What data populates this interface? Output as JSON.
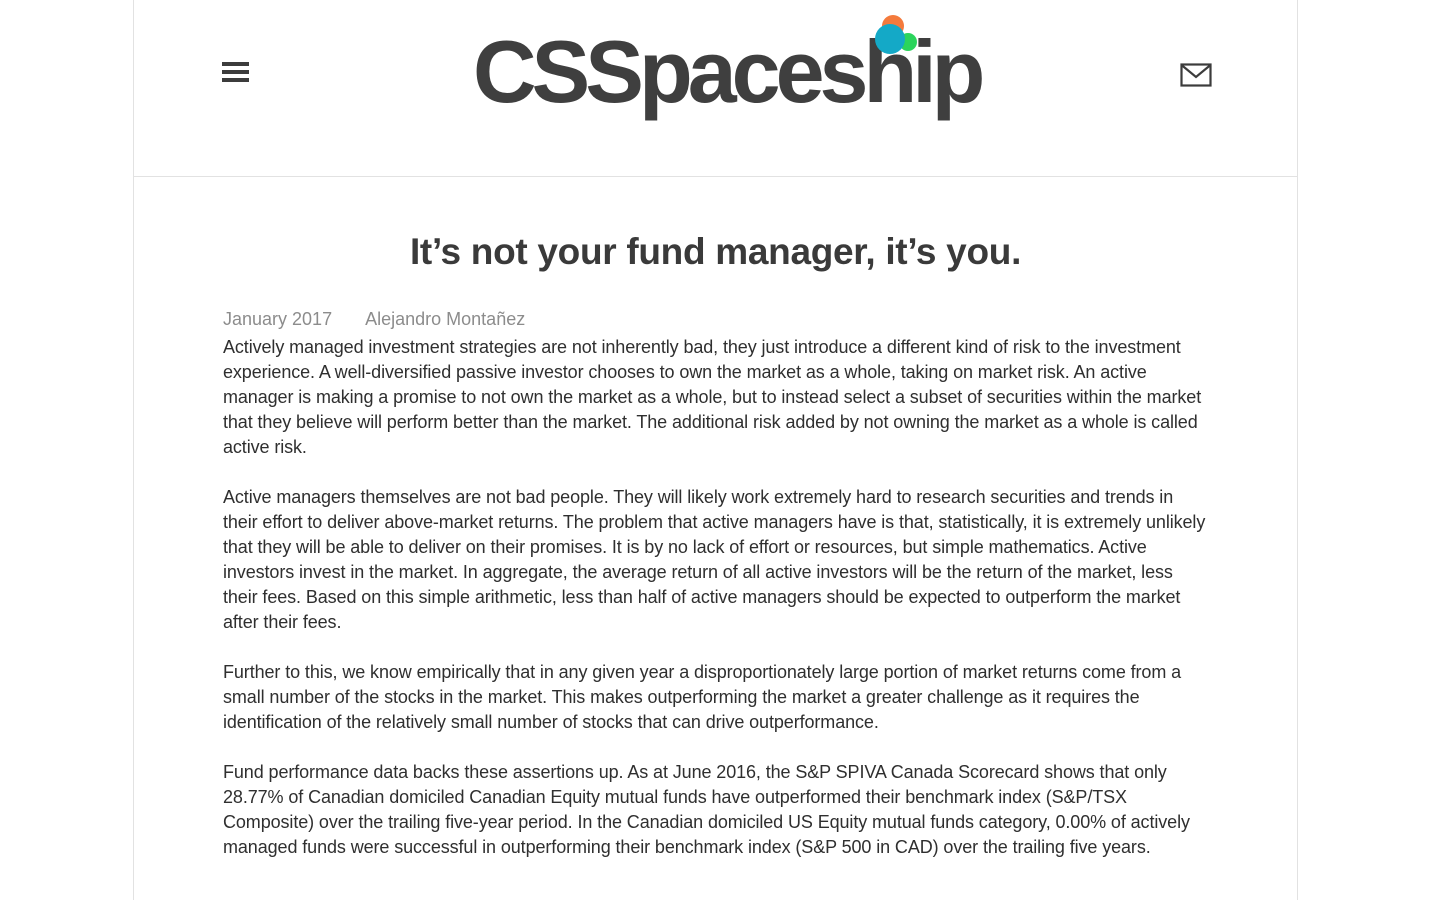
{
  "header": {
    "logo_text": "CSSpaceship",
    "logo_dot_colors": [
      "#f47a3c",
      "#14a9c7",
      "#2bd45c"
    ],
    "menu_icon": "hamburger-menu-icon",
    "mail_icon": "envelope-icon"
  },
  "article": {
    "title": "It’s not your fund manager, it’s you.",
    "date": "January 2017",
    "author": "Alejandro Montañez",
    "paragraphs": [
      "Actively managed investment strategies are not inherently bad, they just introduce a different kind of risk to the investment experience. A well-diversified passive investor chooses to own the market as a whole, taking on market risk. An active manager is making a promise to not own the market as a whole, but to instead select a subset of securities within the market that they believe will perform better than the market. The additional risk added by not owning the market as a whole is called active risk.",
      "Active managers themselves are not bad people. They will likely work extremely hard to research securities and trends in their effort to deliver above-market returns. The problem that active managers have is that, statistically, it is extremely unlikely that they will be able to deliver on their promises. It is by no lack of effort or resources, but simple mathematics. Active investors invest in the market. In aggregate, the average return of all active investors will be the return of the market, less their fees. Based on this simple arithmetic, less than half of active managers should be expected to outperform the market after their fees.",
      "Further to this, we know empirically that in any given year a disproportionately large portion of market returns come from a small number of the stocks in the market. This makes outperforming the market a greater challenge as it requires the identification of the relatively small number of stocks that can drive outperformance.",
      "Fund performance data backs these assertions up. As at June 2016, the S&P SPIVA Canada Scorecard shows that only 28.77% of Canadian domiciled Canadian Equity mutual funds have outperformed their benchmark index (S&P/TSX Composite) over the trailing five-year period. In the Canadian domiciled US Equity mutual funds category, 0.00% of actively managed funds were successful in outperforming their benchmark index (S&P 500 in CAD) over the trailing five years."
    ]
  }
}
